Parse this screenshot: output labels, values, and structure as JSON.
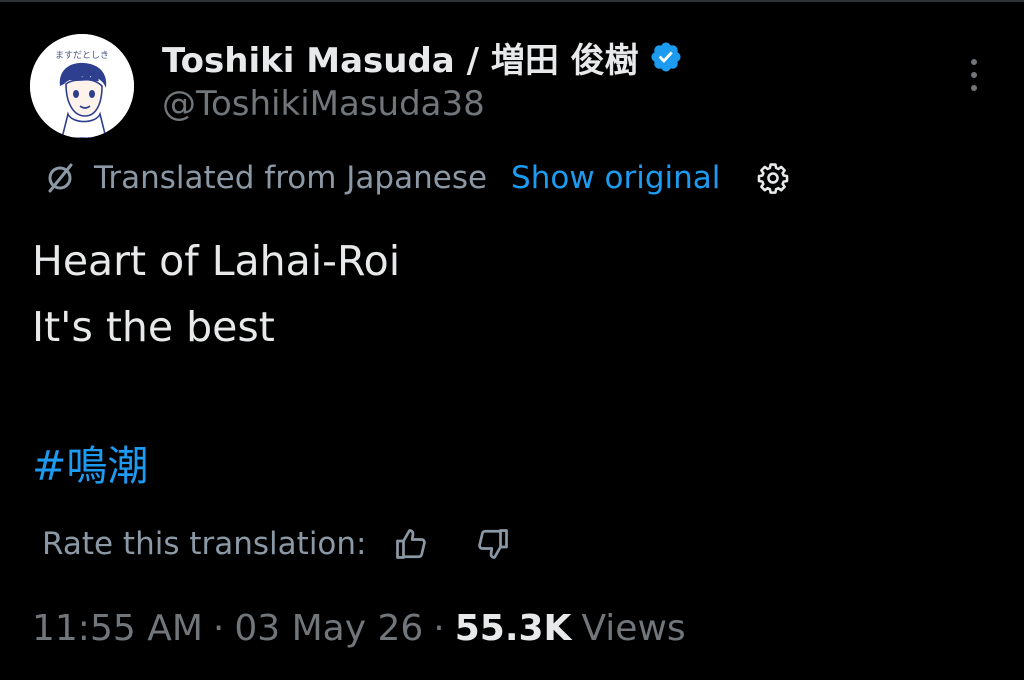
{
  "author": {
    "display_name": "Toshiki Masuda / 増田 俊樹",
    "handle": "@ToshikiMasuda38",
    "verified": true,
    "avatar_caption": "ますだとしき"
  },
  "translation": {
    "label": "Translated from Japanese",
    "show_original": "Show original"
  },
  "tweet": {
    "lines": [
      "Heart of Lahai-Roi",
      "It's the best"
    ],
    "hashtag": "#鳴潮"
  },
  "rate": {
    "label": "Rate this translation:"
  },
  "meta": {
    "time": "11:55 AM",
    "separator": "·",
    "date": "03 May 26",
    "views_count": "55.3K",
    "views_label": "Views"
  },
  "colors": {
    "background": "#000000",
    "primary_text": "#e7e9ea",
    "secondary_text": "#71767b",
    "accent": "#1d9bf0"
  },
  "icons": {
    "verified": "verified-badge-icon",
    "more": "more-vertical-icon",
    "translate": "translate-slash-icon",
    "settings": "gear-icon",
    "thumbs_up": "thumbs-up-icon",
    "thumbs_down": "thumbs-down-icon"
  }
}
